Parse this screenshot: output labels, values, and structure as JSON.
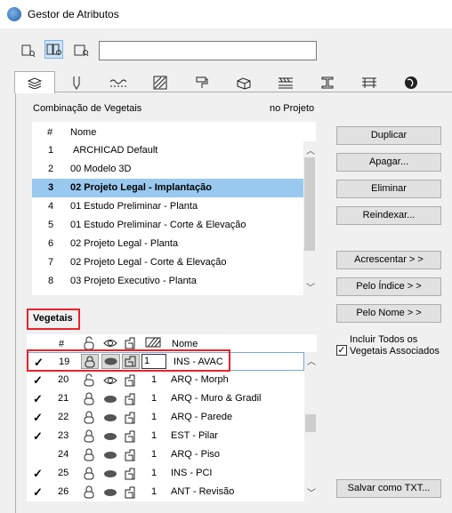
{
  "window": {
    "title": "Gestor de Atributos"
  },
  "toolbar": {
    "search_value": ""
  },
  "tabs": [
    "layers",
    "pens",
    "linetypes",
    "fills",
    "surfaces",
    "building-materials",
    "composites",
    "profiles",
    "zones",
    "globe"
  ],
  "combo_panel": {
    "header_left": "Combinação de Vegetais",
    "header_right": "no Projeto",
    "col_num": "#",
    "col_name": "Nome",
    "rows": [
      {
        "num": "1",
        "name": "ARCHICAD Default"
      },
      {
        "num": "2",
        "name": "00 Modelo 3D"
      },
      {
        "num": "3",
        "name": "02 Projeto Legal - Implantação"
      },
      {
        "num": "4",
        "name": "01 Estudo Preliminar - Planta"
      },
      {
        "num": "5",
        "name": "01 Estudo Preliminar - Corte & Elevação"
      },
      {
        "num": "6",
        "name": "02 Projeto Legal - Planta"
      },
      {
        "num": "7",
        "name": "02 Projeto Legal - Corte & Elevação"
      },
      {
        "num": "8",
        "name": "03 Projeto Executivo - Planta"
      }
    ]
  },
  "buttons": {
    "duplicate": "Duplicar",
    "clear": "Apagar...",
    "delete": "Eliminar",
    "reindex": "Reindexar...",
    "add": "Acrescentar > >",
    "by_index": "Pelo Índice > >",
    "by_name": "Pelo Nome > >",
    "save_txt": "Salvar como TXT..."
  },
  "layers_panel": {
    "title": "Vegetais",
    "col_num": "#",
    "col_name": "Nome",
    "include_label_1": "Incluir Todos os",
    "include_label_2": "Vegetais Associados",
    "rows": [
      {
        "check": "✓",
        "num": "19",
        "intersection": "1",
        "name": "INS - AVAC"
      },
      {
        "check": "✓",
        "num": "20",
        "intersection": "1",
        "name": "ARQ - Morph"
      },
      {
        "check": "✓",
        "num": "21",
        "intersection": "1",
        "name": "ARQ - Muro & Gradil"
      },
      {
        "check": "✓",
        "num": "22",
        "intersection": "1",
        "name": "ARQ - Parede"
      },
      {
        "check": "✓",
        "num": "23",
        "intersection": "1",
        "name": "EST - Pilar"
      },
      {
        "check": "",
        "num": "24",
        "intersection": "1",
        "name": "ARQ - Piso"
      },
      {
        "check": "✓",
        "num": "25",
        "intersection": "1",
        "name": "INS - PCI"
      },
      {
        "check": "✓",
        "num": "26",
        "intersection": "1",
        "name": "ANT - Revisão"
      }
    ]
  }
}
